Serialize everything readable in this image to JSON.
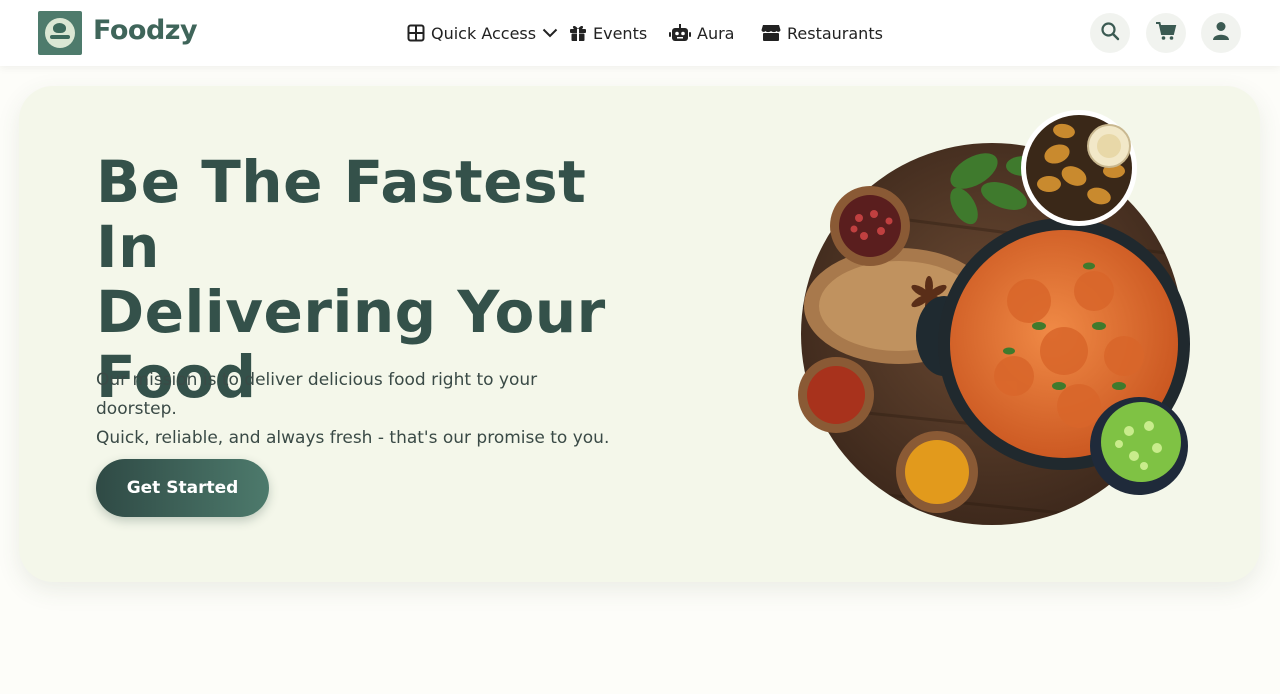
{
  "brand": {
    "name": "Foodzy",
    "logo_text": "FOODZY"
  },
  "nav": {
    "items": [
      {
        "label": "Quick Access",
        "icon": "grid-icon",
        "has_dropdown": true
      },
      {
        "label": "Events",
        "icon": "gift-icon"
      },
      {
        "label": "Aura",
        "icon": "robot-icon"
      },
      {
        "label": "Restaurants",
        "icon": "store-icon"
      }
    ],
    "actions": [
      {
        "icon": "search-icon"
      },
      {
        "icon": "cart-icon"
      },
      {
        "icon": "user-icon"
      }
    ]
  },
  "hero": {
    "title_line1": "Be The Fastest In",
    "title_line2": "Delivering Your",
    "title_line3": "Food",
    "description_line1": "Our mission is to deliver delicious food right to your doorstep.",
    "description_line2": "Quick, reliable, and always fresh - that's our promise to you.",
    "cta_label": "Get Started",
    "image_icon": "food-platter-image"
  },
  "colors": {
    "brand": "#3f655a",
    "hero_bg": "#f4f7ea",
    "title": "#34514a",
    "cta_start": "#2f4a45",
    "cta_end": "#4d7a6c"
  }
}
